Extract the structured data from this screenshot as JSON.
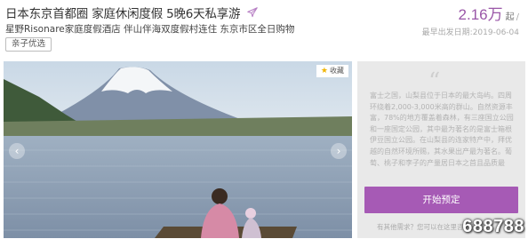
{
  "header": {
    "title": "日本东京首都圈 家庭休闲度假 5晚6天私享游",
    "subtitle": "星野Risonare家庭度假酒店 伴山伴海双度假村连住 东京市区全日购物",
    "tag": "亲子优选"
  },
  "price": {
    "amount": "2.16万",
    "unit": "起",
    "separator": "/",
    "date": "最早出发日期:2019-06-04",
    "color": "#9a57a8"
  },
  "photo": {
    "favorite_label": "收藏"
  },
  "panel": {
    "quote_mark": "“",
    "description": "富士之国，山梨县位于日本的最大岛屿。四周环绕着2,000-3,000米高的群山。自然资源丰富，78%的地方覆盖着森林，有三座国立公园和一座国定公园，其中最为著名的是富士箱根伊豆国立公园。在山梨县的连家特产中，拜优越的自然环境所赐，其水果出产最为著名。葡萄、桃子和李子的产量居日本之首且品质最",
    "book_button": "开始预定",
    "help_text": "有其他需求？您可以在这里咨询我们",
    "accent": "#a65ab5"
  },
  "watermark": "688788"
}
